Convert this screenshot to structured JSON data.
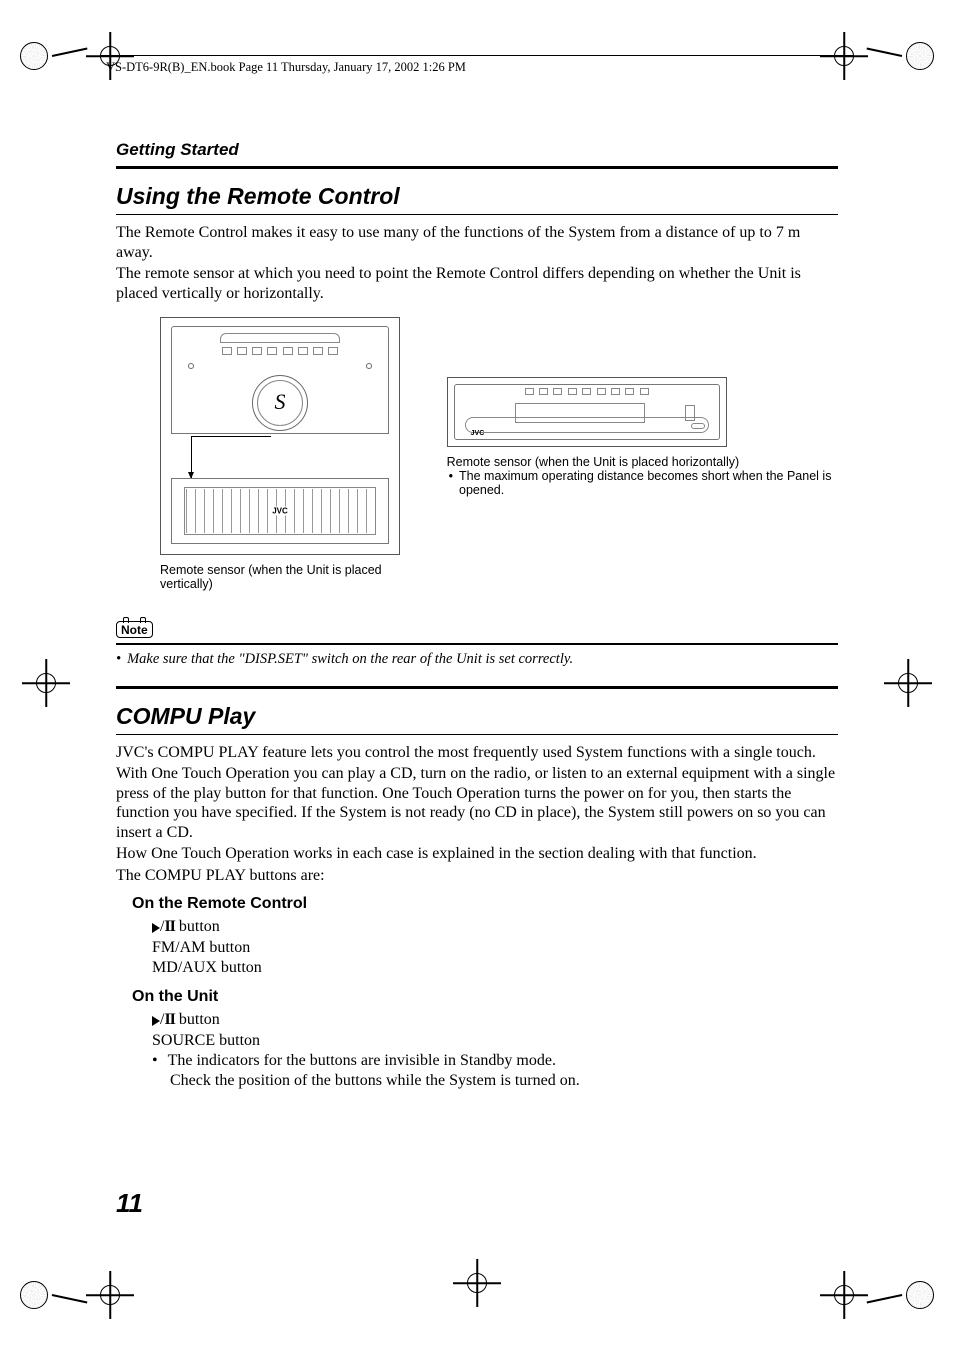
{
  "header_line": "VS-DT6-9R(B)_EN.book  Page 11  Thursday, January 17, 2002  1:26 PM",
  "section_label": "Getting Started",
  "h_using": "Using the Remote Control",
  "p1": "The Remote Control makes it easy to use many of the functions of the System from a distance of up to 7 m away.",
  "p2": "The remote sensor at which you need to point the Remote Control differs depending on whether the Unit is placed vertically or horizontally.",
  "caption_v": "Remote sensor (when the Unit is placed vertically)",
  "caption_h": "Remote sensor (when the Unit is placed horizontally)",
  "caption_h_bullet": "The maximum operating distance becomes short when the Panel is opened.",
  "note_label": "Note",
  "note_text": "Make sure that the \"DISP.SET\" switch on the rear of the Unit is set correctly.",
  "h_compu": "COMPU Play",
  "cp1": "JVC's COMPU PLAY feature lets you control the most frequently used System functions with a single touch.",
  "cp2": "With One Touch Operation you can play a CD, turn on the radio, or listen to an external equipment with a single press of the play button for that function. One Touch Operation turns the power on for you, then starts the function you have specified. If the System is not ready (no CD in place), the System still powers on so you can insert a CD.",
  "cp3": "How One Touch Operation works in each case is explained in the section dealing with that function.",
  "cp4": "The COMPU PLAY buttons are:",
  "sub_remote": "On the Remote Control",
  "rc_btn1_suffix": " button",
  "rc_btn2": "FM/AM button",
  "rc_btn3": "MD/AUX button",
  "sub_unit": "On the Unit",
  "unit_btn1_suffix": " button",
  "unit_btn2": "SOURCE button",
  "unit_b1": "The indicators for the buttons are invisible in Standby mode.",
  "unit_b1_sub": "Check the position of the buttons while the System is turned on.",
  "page_number": "11",
  "fig_jvc": "JVC"
}
